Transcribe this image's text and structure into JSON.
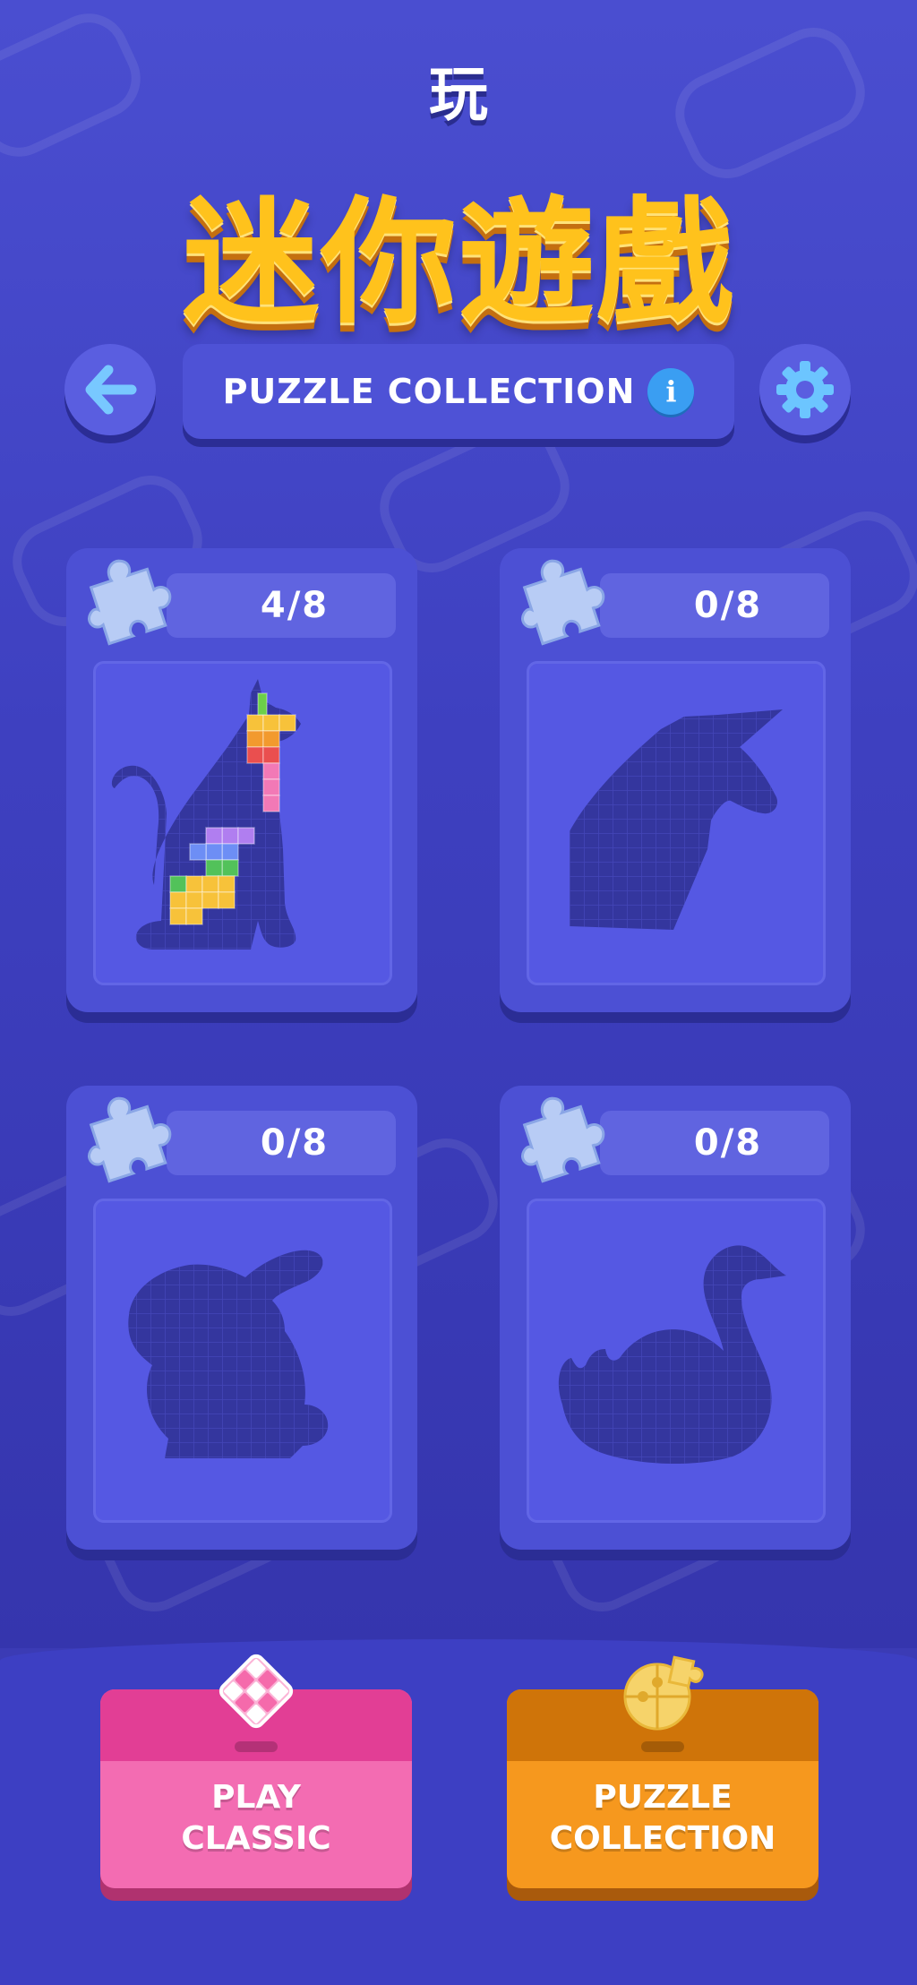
{
  "header": {
    "small_title": "玩",
    "big_title": "迷你遊戲",
    "section_label": "PUZZLE COLLECTION",
    "info_glyph": "i"
  },
  "icons": {
    "back": "arrow-left-icon",
    "settings": "gear-icon",
    "info": "info-icon",
    "puzzle_piece": "puzzle-piece-icon"
  },
  "colors": {
    "background": "#4448c8",
    "title_gold": "#ffc21c",
    "card": "#4c50d4",
    "silhouette": "#34369e",
    "classic_pink": "#f36cb2",
    "collection_orange": "#f6981e",
    "accent_blue": "#3a9ef2"
  },
  "puzzles": [
    {
      "name": "cat",
      "progress": "4/8",
      "completed": 4,
      "total": 8
    },
    {
      "name": "unicorn",
      "progress": "0/8",
      "completed": 0,
      "total": 8
    },
    {
      "name": "rabbit",
      "progress": "0/8",
      "completed": 0,
      "total": 8
    },
    {
      "name": "swan",
      "progress": "0/8",
      "completed": 0,
      "total": 8
    }
  ],
  "bottom_buttons": {
    "classic_line1": "PLAY",
    "classic_line2": "CLASSIC",
    "collection_line1": "PUZZLE",
    "collection_line2": "COLLECTION"
  }
}
